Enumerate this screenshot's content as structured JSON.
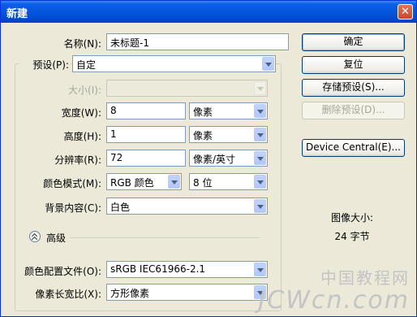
{
  "window": {
    "title": "新建",
    "close_icon": "close-icon"
  },
  "form": {
    "name": {
      "label": "名称(N):",
      "value": "未标题-1"
    },
    "preset": {
      "label": "预设(P):",
      "value": "自定"
    },
    "size": {
      "label": "大小(I):",
      "value": ""
    },
    "width": {
      "label": "宽度(W):",
      "value": "8",
      "unit": "像素"
    },
    "height": {
      "label": "高度(H):",
      "value": "1",
      "unit": "像素"
    },
    "resolution": {
      "label": "分辨率(R):",
      "value": "72",
      "unit": "像素/英寸"
    },
    "color_mode": {
      "label": "颜色模式(M):",
      "value": "RGB 颜色",
      "bits": "8 位"
    },
    "background": {
      "label": "背景内容(C):",
      "value": "白色"
    },
    "advanced": {
      "label": "高级"
    },
    "color_profile": {
      "label": "颜色配置文件(O):",
      "value": "sRGB IEC61966-2.1"
    },
    "pixel_aspect": {
      "label": "像素长宽比(X):",
      "value": "方形像素"
    }
  },
  "buttons": {
    "ok": "确定",
    "reset": "复位",
    "save_preset": "存储预设(S)...",
    "delete_preset": "删除预设(D)...",
    "device_central": "Device Central(E)..."
  },
  "image_size": {
    "label": "图像大小:",
    "value": "24 字节"
  },
  "watermark": {
    "cn": "中国教程网",
    "en": "JCWcn.com"
  }
}
